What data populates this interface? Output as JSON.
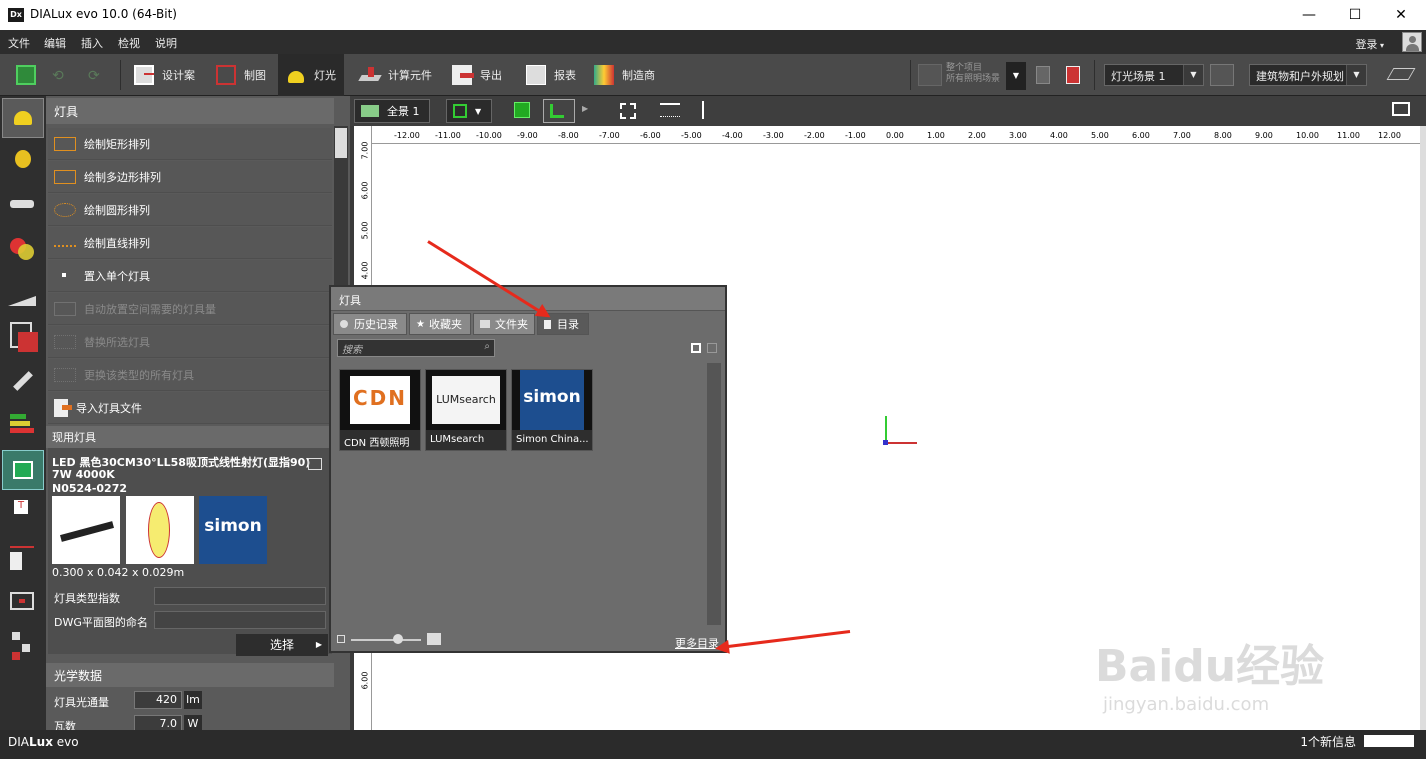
{
  "window": {
    "title": "DIALux evo 10.0  (64-Bit)",
    "icon_text": "Dx",
    "minimize": "—",
    "maximize": "☐",
    "close": "✕"
  },
  "menu": {
    "items": [
      "文件",
      "编辑",
      "插入",
      "检视",
      "说明"
    ],
    "login": "登录"
  },
  "toolbar": {
    "buttons": [
      "设计案",
      "制图",
      "灯光",
      "计算元件",
      "导出",
      "报表",
      "制造商"
    ],
    "active": "灯光",
    "calc_label_line1": "整个项目",
    "calc_label_line2": "所有照明场景",
    "light_scene": "灯光场景 1",
    "planning": "建筑物和户外规划"
  },
  "panel": {
    "title": "灯具",
    "actions": [
      {
        "label": "绘制矩形排列",
        "enabled": true
      },
      {
        "label": "绘制多边形排列",
        "enabled": true
      },
      {
        "label": "绘制圆形排列",
        "enabled": true
      },
      {
        "label": "绘制直线排列",
        "enabled": true
      },
      {
        "label": "置入单个灯具",
        "enabled": true
      },
      {
        "label": "自动放置空间需要的灯具量",
        "enabled": false
      },
      {
        "label": "替换所选灯具",
        "enabled": false
      },
      {
        "label": "更换该类型的所有灯具",
        "enabled": false
      },
      {
        "label": "导入灯具文件",
        "enabled": true
      }
    ],
    "current": {
      "header": "现用灯具",
      "name_line1": "LED 黑色30CM30°LL58吸顶式线性射灯(显指90)",
      "name_line2": "7W 4000K",
      "name_line3": "N0524-0272",
      "dimensions": "0.300 x 0.042 x 0.029m",
      "type_index_label": "灯具类型指数",
      "dwg_label": "DWG平面图的命名",
      "select_button": "选择"
    },
    "optical": {
      "header": "光学数据",
      "rows": [
        {
          "label": "灯具光通量",
          "value": "420",
          "unit": "lm"
        },
        {
          "label": "瓦数",
          "value": "7.0",
          "unit": "W"
        }
      ]
    }
  },
  "viewport": {
    "view_label": "全景 1",
    "ruler_h": [
      "-12.00",
      "-11.00",
      "-10.00",
      "-9.00",
      "-8.00",
      "-7.00",
      "-6.00",
      "-5.00",
      "-4.00",
      "-3.00",
      "-2.00",
      "-1.00",
      "0.00",
      "1.00",
      "2.00",
      "3.00",
      "4.00",
      "5.00",
      "6.00",
      "7.00",
      "8.00",
      "9.00",
      "10.00",
      "11.00",
      "12.00"
    ],
    "ruler_v": [
      "7.00",
      "6.00",
      "5.00",
      "4.00",
      "6.00"
    ]
  },
  "dialog": {
    "title": "灯具",
    "tabs": [
      "历史记录",
      "收藏夹",
      "文件夹",
      "目录"
    ],
    "active_tab": "目录",
    "search_placeholder": "搜索",
    "catalogs": [
      {
        "label": "CDN 西顿照明",
        "logo": "CDN"
      },
      {
        "label": "LUMsearch",
        "logo": "LUMsearch"
      },
      {
        "label": "Simon China...",
        "logo": "simon"
      }
    ],
    "more_link": "更多目录"
  },
  "status": {
    "brand_prefix": "DIA",
    "brand_bold": "Lux",
    "brand_suffix": " evo",
    "message": "1个新信息"
  },
  "watermark": {
    "text": "Baidu经验",
    "url": "jingyan.baidu.com"
  },
  "colors": {
    "accent_red": "#e62a1c",
    "simon_blue": "#1d4e8f"
  }
}
